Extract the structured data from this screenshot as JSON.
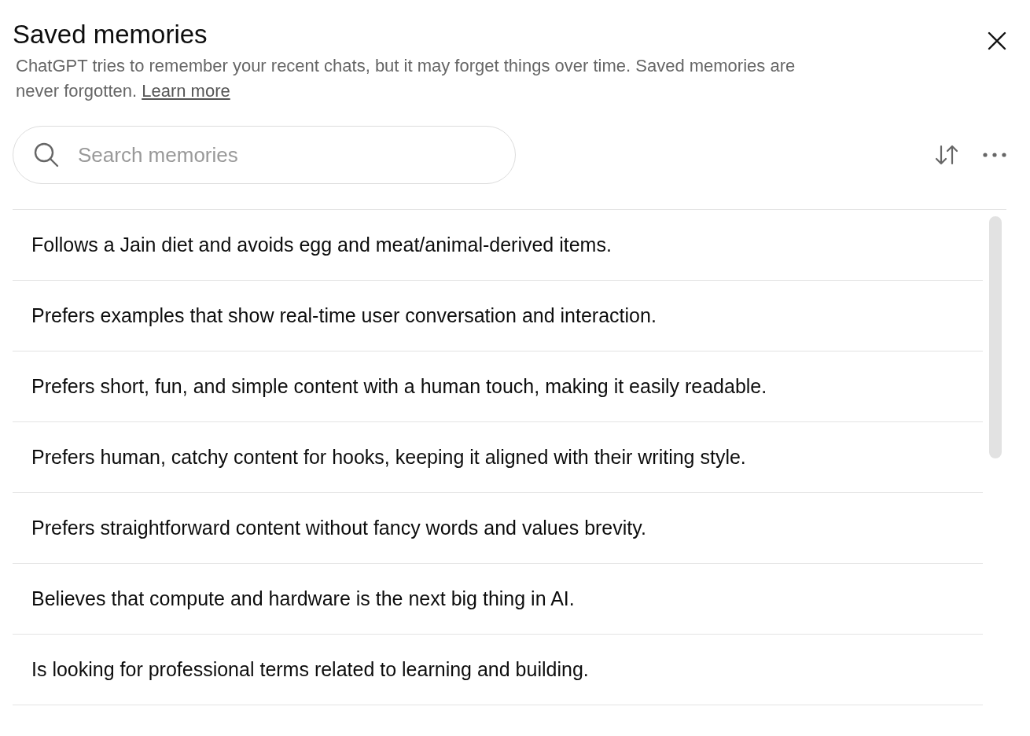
{
  "dialog": {
    "title": "Saved memories",
    "description": "ChatGPT tries to remember your recent chats, but it may forget things over time. Saved memories are never forgotten.",
    "learn_more": "Learn more"
  },
  "search": {
    "placeholder": "Search memories"
  },
  "memories": [
    {
      "text": "Follows a Jain diet and avoids egg and meat/animal-derived items."
    },
    {
      "text": "Prefers examples that show real-time user conversation and interaction."
    },
    {
      "text": "Prefers short, fun, and simple content with a human touch, making it easily readable."
    },
    {
      "text": "Prefers human, catchy content for hooks, keeping it aligned with their writing style."
    },
    {
      "text": "Prefers straightforward content without fancy words and values brevity."
    },
    {
      "text": "Believes that compute and hardware is the next big thing in AI."
    },
    {
      "text": "Is looking for professional terms related to learning and building."
    }
  ]
}
